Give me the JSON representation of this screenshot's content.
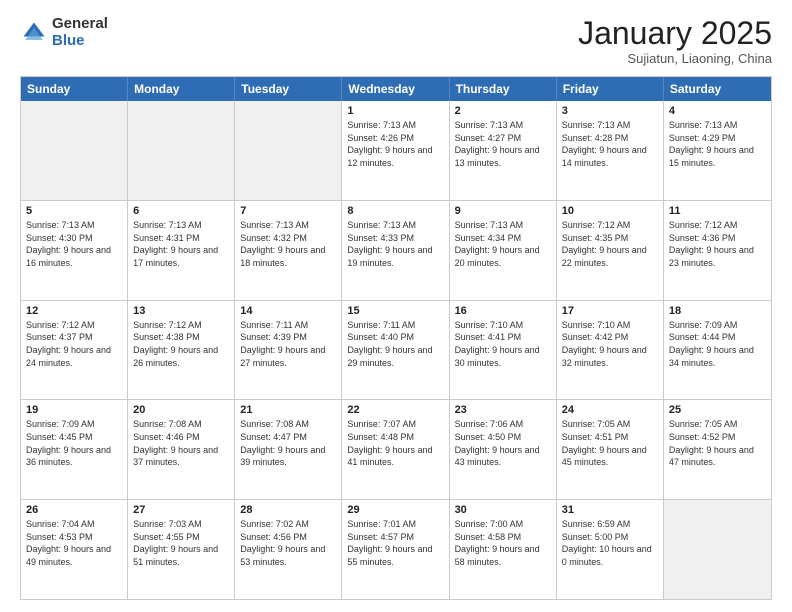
{
  "header": {
    "logo_general": "General",
    "logo_blue": "Blue",
    "month_title": "January 2025",
    "subtitle": "Sujiatun, Liaoning, China"
  },
  "days_of_week": [
    "Sunday",
    "Monday",
    "Tuesday",
    "Wednesday",
    "Thursday",
    "Friday",
    "Saturday"
  ],
  "weeks": [
    [
      {
        "day": "",
        "sunrise": "",
        "sunset": "",
        "daylight": "",
        "empty": true
      },
      {
        "day": "",
        "sunrise": "",
        "sunset": "",
        "daylight": "",
        "empty": true
      },
      {
        "day": "",
        "sunrise": "",
        "sunset": "",
        "daylight": "",
        "empty": true
      },
      {
        "day": "1",
        "sunrise": "Sunrise: 7:13 AM",
        "sunset": "Sunset: 4:26 PM",
        "daylight": "Daylight: 9 hours and 12 minutes.",
        "empty": false
      },
      {
        "day": "2",
        "sunrise": "Sunrise: 7:13 AM",
        "sunset": "Sunset: 4:27 PM",
        "daylight": "Daylight: 9 hours and 13 minutes.",
        "empty": false
      },
      {
        "day": "3",
        "sunrise": "Sunrise: 7:13 AM",
        "sunset": "Sunset: 4:28 PM",
        "daylight": "Daylight: 9 hours and 14 minutes.",
        "empty": false
      },
      {
        "day": "4",
        "sunrise": "Sunrise: 7:13 AM",
        "sunset": "Sunset: 4:29 PM",
        "daylight": "Daylight: 9 hours and 15 minutes.",
        "empty": false
      }
    ],
    [
      {
        "day": "5",
        "sunrise": "Sunrise: 7:13 AM",
        "sunset": "Sunset: 4:30 PM",
        "daylight": "Daylight: 9 hours and 16 minutes.",
        "empty": false
      },
      {
        "day": "6",
        "sunrise": "Sunrise: 7:13 AM",
        "sunset": "Sunset: 4:31 PM",
        "daylight": "Daylight: 9 hours and 17 minutes.",
        "empty": false
      },
      {
        "day": "7",
        "sunrise": "Sunrise: 7:13 AM",
        "sunset": "Sunset: 4:32 PM",
        "daylight": "Daylight: 9 hours and 18 minutes.",
        "empty": false
      },
      {
        "day": "8",
        "sunrise": "Sunrise: 7:13 AM",
        "sunset": "Sunset: 4:33 PM",
        "daylight": "Daylight: 9 hours and 19 minutes.",
        "empty": false
      },
      {
        "day": "9",
        "sunrise": "Sunrise: 7:13 AM",
        "sunset": "Sunset: 4:34 PM",
        "daylight": "Daylight: 9 hours and 20 minutes.",
        "empty": false
      },
      {
        "day": "10",
        "sunrise": "Sunrise: 7:12 AM",
        "sunset": "Sunset: 4:35 PM",
        "daylight": "Daylight: 9 hours and 22 minutes.",
        "empty": false
      },
      {
        "day": "11",
        "sunrise": "Sunrise: 7:12 AM",
        "sunset": "Sunset: 4:36 PM",
        "daylight": "Daylight: 9 hours and 23 minutes.",
        "empty": false
      }
    ],
    [
      {
        "day": "12",
        "sunrise": "Sunrise: 7:12 AM",
        "sunset": "Sunset: 4:37 PM",
        "daylight": "Daylight: 9 hours and 24 minutes.",
        "empty": false
      },
      {
        "day": "13",
        "sunrise": "Sunrise: 7:12 AM",
        "sunset": "Sunset: 4:38 PM",
        "daylight": "Daylight: 9 hours and 26 minutes.",
        "empty": false
      },
      {
        "day": "14",
        "sunrise": "Sunrise: 7:11 AM",
        "sunset": "Sunset: 4:39 PM",
        "daylight": "Daylight: 9 hours and 27 minutes.",
        "empty": false
      },
      {
        "day": "15",
        "sunrise": "Sunrise: 7:11 AM",
        "sunset": "Sunset: 4:40 PM",
        "daylight": "Daylight: 9 hours and 29 minutes.",
        "empty": false
      },
      {
        "day": "16",
        "sunrise": "Sunrise: 7:10 AM",
        "sunset": "Sunset: 4:41 PM",
        "daylight": "Daylight: 9 hours and 30 minutes.",
        "empty": false
      },
      {
        "day": "17",
        "sunrise": "Sunrise: 7:10 AM",
        "sunset": "Sunset: 4:42 PM",
        "daylight": "Daylight: 9 hours and 32 minutes.",
        "empty": false
      },
      {
        "day": "18",
        "sunrise": "Sunrise: 7:09 AM",
        "sunset": "Sunset: 4:44 PM",
        "daylight": "Daylight: 9 hours and 34 minutes.",
        "empty": false
      }
    ],
    [
      {
        "day": "19",
        "sunrise": "Sunrise: 7:09 AM",
        "sunset": "Sunset: 4:45 PM",
        "daylight": "Daylight: 9 hours and 36 minutes.",
        "empty": false
      },
      {
        "day": "20",
        "sunrise": "Sunrise: 7:08 AM",
        "sunset": "Sunset: 4:46 PM",
        "daylight": "Daylight: 9 hours and 37 minutes.",
        "empty": false
      },
      {
        "day": "21",
        "sunrise": "Sunrise: 7:08 AM",
        "sunset": "Sunset: 4:47 PM",
        "daylight": "Daylight: 9 hours and 39 minutes.",
        "empty": false
      },
      {
        "day": "22",
        "sunrise": "Sunrise: 7:07 AM",
        "sunset": "Sunset: 4:48 PM",
        "daylight": "Daylight: 9 hours and 41 minutes.",
        "empty": false
      },
      {
        "day": "23",
        "sunrise": "Sunrise: 7:06 AM",
        "sunset": "Sunset: 4:50 PM",
        "daylight": "Daylight: 9 hours and 43 minutes.",
        "empty": false
      },
      {
        "day": "24",
        "sunrise": "Sunrise: 7:05 AM",
        "sunset": "Sunset: 4:51 PM",
        "daylight": "Daylight: 9 hours and 45 minutes.",
        "empty": false
      },
      {
        "day": "25",
        "sunrise": "Sunrise: 7:05 AM",
        "sunset": "Sunset: 4:52 PM",
        "daylight": "Daylight: 9 hours and 47 minutes.",
        "empty": false
      }
    ],
    [
      {
        "day": "26",
        "sunrise": "Sunrise: 7:04 AM",
        "sunset": "Sunset: 4:53 PM",
        "daylight": "Daylight: 9 hours and 49 minutes.",
        "empty": false
      },
      {
        "day": "27",
        "sunrise": "Sunrise: 7:03 AM",
        "sunset": "Sunset: 4:55 PM",
        "daylight": "Daylight: 9 hours and 51 minutes.",
        "empty": false
      },
      {
        "day": "28",
        "sunrise": "Sunrise: 7:02 AM",
        "sunset": "Sunset: 4:56 PM",
        "daylight": "Daylight: 9 hours and 53 minutes.",
        "empty": false
      },
      {
        "day": "29",
        "sunrise": "Sunrise: 7:01 AM",
        "sunset": "Sunset: 4:57 PM",
        "daylight": "Daylight: 9 hours and 55 minutes.",
        "empty": false
      },
      {
        "day": "30",
        "sunrise": "Sunrise: 7:00 AM",
        "sunset": "Sunset: 4:58 PM",
        "daylight": "Daylight: 9 hours and 58 minutes.",
        "empty": false
      },
      {
        "day": "31",
        "sunrise": "Sunrise: 6:59 AM",
        "sunset": "Sunset: 5:00 PM",
        "daylight": "Daylight: 10 hours and 0 minutes.",
        "empty": false
      },
      {
        "day": "",
        "sunrise": "",
        "sunset": "",
        "daylight": "",
        "empty": true
      }
    ]
  ]
}
